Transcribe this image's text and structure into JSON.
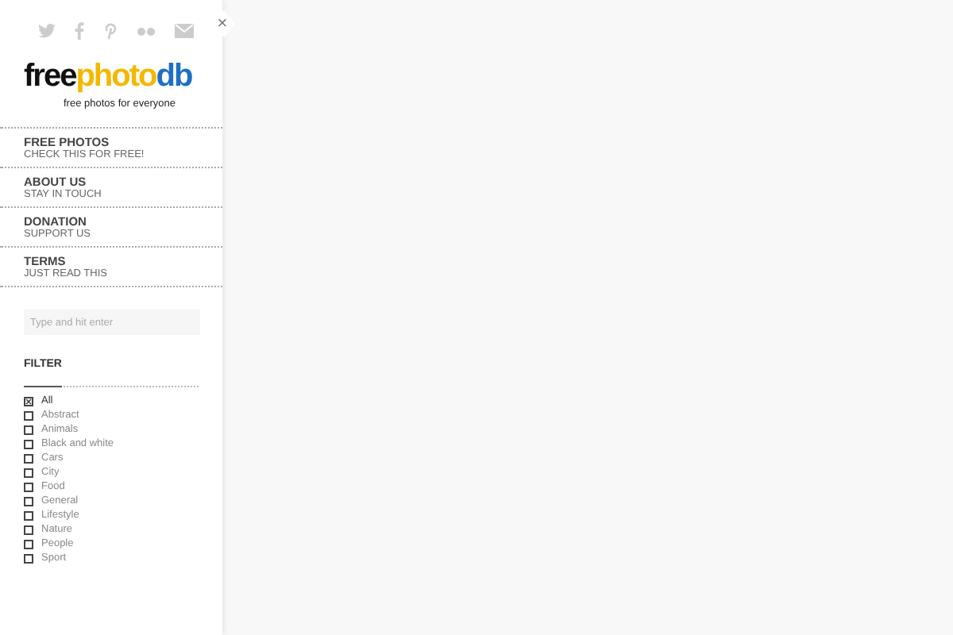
{
  "close_button": "×",
  "logo": {
    "parts": [
      {
        "text": "free",
        "color": "#111111"
      },
      {
        "text": "photo",
        "color": "#f4b800"
      },
      {
        "text": "db",
        "color": "#1e6fc4"
      }
    ],
    "tagline": "free photos for everyone"
  },
  "menu": [
    {
      "title": "FREE PHOTOS",
      "subtitle": "CHECK THIS FOR FREE!"
    },
    {
      "title": "ABOUT US",
      "subtitle": "STAY IN TOUCH"
    },
    {
      "title": "DONATION",
      "subtitle": "SUPPORT US"
    },
    {
      "title": "TERMS",
      "subtitle": "JUST READ THIS"
    }
  ],
  "search": {
    "placeholder": "Type and hit enter"
  },
  "filter": {
    "title": "FILTER",
    "items": [
      {
        "label": "All",
        "checked": true
      },
      {
        "label": "Abstract",
        "checked": false
      },
      {
        "label": "Animals",
        "checked": false
      },
      {
        "label": "Black and white",
        "checked": false
      },
      {
        "label": "Cars",
        "checked": false
      },
      {
        "label": "City",
        "checked": false
      },
      {
        "label": "Food",
        "checked": false
      },
      {
        "label": "General",
        "checked": false
      },
      {
        "label": "Lifestyle",
        "checked": false
      },
      {
        "label": "Nature",
        "checked": false
      },
      {
        "label": "People",
        "checked": false
      },
      {
        "label": "Sport",
        "checked": false
      }
    ]
  }
}
